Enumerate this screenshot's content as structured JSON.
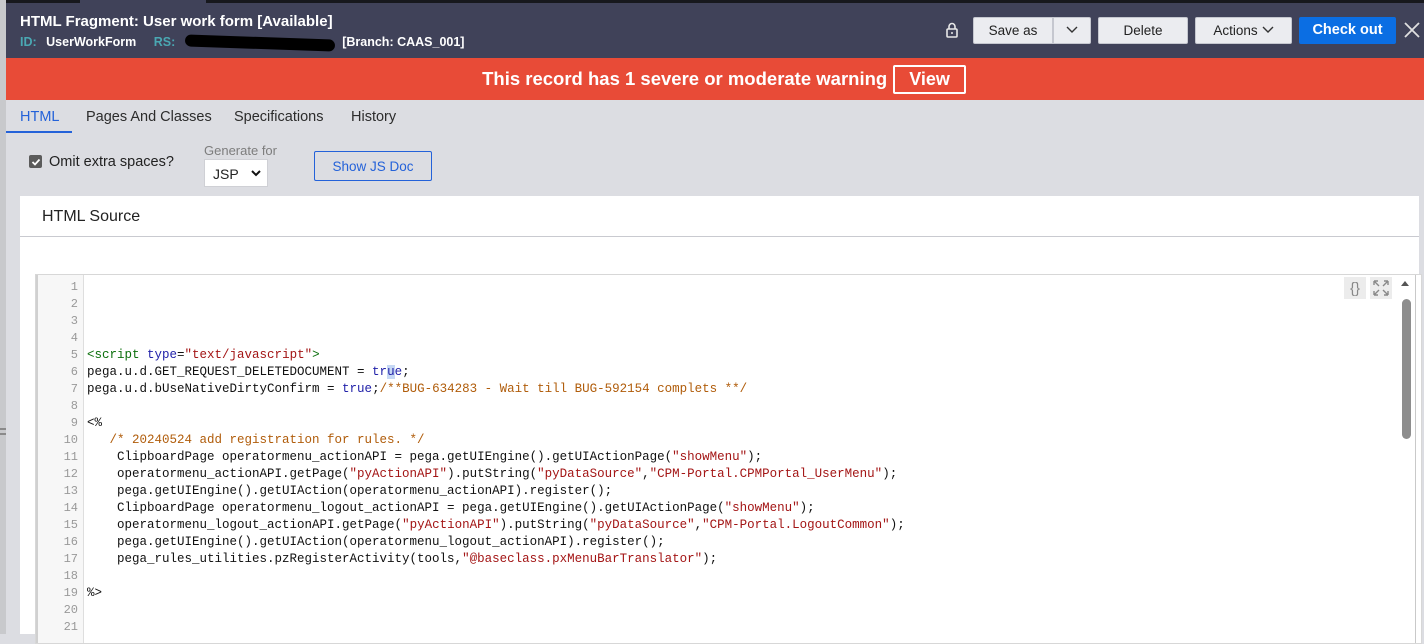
{
  "header": {
    "title": "HTML Fragment: User work form",
    "status": "[Available]",
    "id_label": "ID:",
    "id_value": "UserWorkForm",
    "rs_label": "RS:",
    "rs_value_visible_tail": "[Branch: CAAS_001]",
    "buttons": {
      "save_as": "Save as",
      "delete": "Delete",
      "actions": "Actions",
      "check_out": "Check out"
    }
  },
  "warning": {
    "text": "This record has 1 severe or moderate warning",
    "view_label": "View",
    "color": "#e84b37"
  },
  "tabs": [
    {
      "label": "HTML",
      "active": true
    },
    {
      "label": "Pages And Classes",
      "active": false
    },
    {
      "label": "Specifications",
      "active": false
    },
    {
      "label": "History",
      "active": false
    }
  ],
  "options": {
    "omit_spaces_label": "Omit extra spaces?",
    "omit_spaces_checked": true,
    "generate_for_label": "Generate for",
    "generate_for_value": "JSP",
    "show_js_doc": "Show JS Doc"
  },
  "panel": {
    "title": "HTML Source"
  },
  "code": {
    "lines": [
      {
        "n": "1",
        "segments": []
      },
      {
        "n": "2",
        "segments": []
      },
      {
        "n": "3",
        "segments": []
      },
      {
        "n": "4",
        "segments": []
      },
      {
        "n": "5",
        "segments": [
          {
            "t": "<script ",
            "c": "c-tag"
          },
          {
            "t": "type",
            "c": "c-attr"
          },
          {
            "t": "=",
            "c": ""
          },
          {
            "t": "\"text/javascript\"",
            "c": "c-str"
          },
          {
            "t": ">",
            "c": "c-tag"
          }
        ]
      },
      {
        "n": "6",
        "segments": [
          {
            "t": "pega.u.d.GET_REQUEST_DELETEDOCUMENT = ",
            "c": ""
          },
          {
            "t": "tr",
            "c": "c-kw"
          },
          {
            "t": "u",
            "c": "c-kw cursor-hl"
          },
          {
            "t": "e",
            "c": "c-kw"
          },
          {
            "t": ";",
            "c": ""
          }
        ]
      },
      {
        "n": "7",
        "segments": [
          {
            "t": "pega.u.d.bUseNativeDirtyConfirm = ",
            "c": ""
          },
          {
            "t": "true",
            "c": "c-kw"
          },
          {
            "t": ";",
            "c": ""
          },
          {
            "t": "/**BUG-634283 - Wait till BUG-592154 complets **/",
            "c": "c-cmt"
          }
        ]
      },
      {
        "n": "8",
        "segments": []
      },
      {
        "n": "9",
        "segments": [
          {
            "t": "<%",
            "c": ""
          }
        ]
      },
      {
        "n": "10",
        "segments": [
          {
            "t": "   /* 20240524 add registration for rules. */",
            "c": "c-cmt"
          }
        ]
      },
      {
        "n": "11",
        "segments": [
          {
            "t": "    ClipboardPage operatormenu_actionAPI = pega.getUIEngine().getUIActionPage(",
            "c": ""
          },
          {
            "t": "\"showMenu\"",
            "c": "c-str"
          },
          {
            "t": ");",
            "c": ""
          }
        ]
      },
      {
        "n": "12",
        "segments": [
          {
            "t": "    operatormenu_actionAPI.getPage(",
            "c": ""
          },
          {
            "t": "\"pyActionAPI\"",
            "c": "c-str"
          },
          {
            "t": ").putString(",
            "c": ""
          },
          {
            "t": "\"pyDataSource\"",
            "c": "c-str"
          },
          {
            "t": ",",
            "c": ""
          },
          {
            "t": "\"CPM-Portal.CPMPortal_UserMenu\"",
            "c": "c-str"
          },
          {
            "t": ");",
            "c": ""
          }
        ]
      },
      {
        "n": "13",
        "segments": [
          {
            "t": "    pega.getUIEngine().getUIAction(operatormenu_actionAPI).register();",
            "c": ""
          }
        ]
      },
      {
        "n": "14",
        "segments": [
          {
            "t": "    ClipboardPage operatormenu_logout_actionAPI = pega.getUIEngine().getUIActionPage(",
            "c": ""
          },
          {
            "t": "\"showMenu\"",
            "c": "c-str"
          },
          {
            "t": ");",
            "c": ""
          }
        ]
      },
      {
        "n": "15",
        "segments": [
          {
            "t": "    operatormenu_logout_actionAPI.getPage(",
            "c": ""
          },
          {
            "t": "\"pyActionAPI\"",
            "c": "c-str"
          },
          {
            "t": ").putString(",
            "c": ""
          },
          {
            "t": "\"pyDataSource\"",
            "c": "c-str"
          },
          {
            "t": ",",
            "c": ""
          },
          {
            "t": "\"CPM-Portal.LogoutCommon\"",
            "c": "c-str"
          },
          {
            "t": ");",
            "c": ""
          }
        ]
      },
      {
        "n": "16",
        "segments": [
          {
            "t": "    pega.getUIEngine().getUIAction(operatormenu_logout_actionAPI).register();",
            "c": ""
          }
        ]
      },
      {
        "n": "17",
        "segments": [
          {
            "t": "    pega_rules_utilities.pzRegisterActivity(tools,",
            "c": ""
          },
          {
            "t": "\"@baseclass.pxMenuBarTranslator\"",
            "c": "c-str"
          },
          {
            "t": ");",
            "c": ""
          }
        ]
      },
      {
        "n": "18",
        "segments": []
      },
      {
        "n": "19",
        "segments": [
          {
            "t": "%>",
            "c": ""
          }
        ]
      },
      {
        "n": "20",
        "segments": []
      },
      {
        "n": "21",
        "segments": []
      }
    ]
  },
  "icons": {
    "lock": "lock-icon",
    "close": "close-icon",
    "format": "format-braces-icon",
    "fullscreen": "fullscreen-icon"
  }
}
